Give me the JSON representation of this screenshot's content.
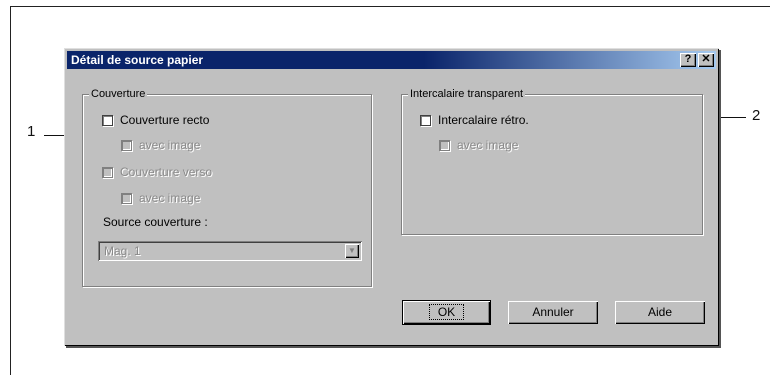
{
  "dialog": {
    "title": "Détail de source papier",
    "help_btn": "?",
    "close_btn": "✕"
  },
  "couverture": {
    "group_title": "Couverture",
    "recto": {
      "label": "Couverture recto",
      "checked": false,
      "enabled": true
    },
    "recto_image": {
      "label": "avec image",
      "checked": false,
      "enabled": false
    },
    "verso": {
      "label": "Couverture verso",
      "checked": false,
      "enabled": false
    },
    "verso_image": {
      "label": "avec image",
      "checked": false,
      "enabled": false
    },
    "source_label": "Source couverture :",
    "source_value": "Mag. 1",
    "dropdown_icon": "chevron-down-icon"
  },
  "intercalaire": {
    "group_title": "Intercalaire transparent",
    "retro": {
      "label": "Intercalaire rétro.",
      "checked": false,
      "enabled": true
    },
    "retro_image": {
      "label": "avec image",
      "checked": false,
      "enabled": false
    }
  },
  "buttons": {
    "ok": "OK",
    "cancel": "Annuler",
    "help": "Aide"
  },
  "callouts": {
    "left": "1",
    "right": "2"
  }
}
